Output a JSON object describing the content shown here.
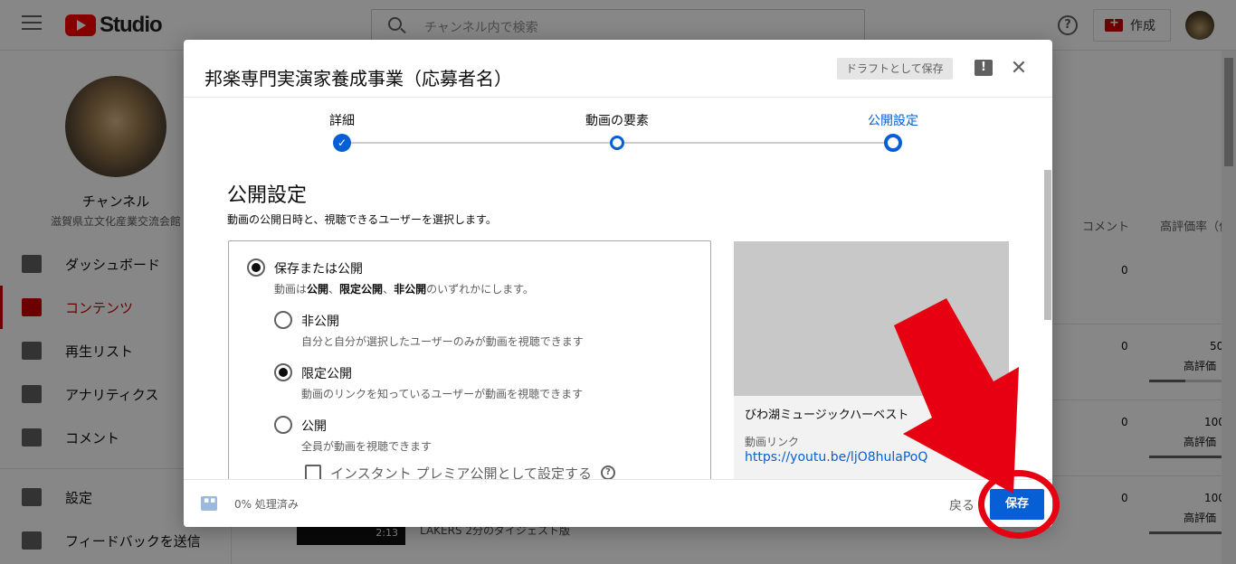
{
  "app": {
    "logo_text": "Studio",
    "search_placeholder": "チャンネル内で検索",
    "help_glyph": "?",
    "create_label": "作成"
  },
  "sidebar": {
    "channel_name": "チャンネル",
    "channel_sub": "滋賀県立文化産業交流会館",
    "items": [
      {
        "label": "ダッシュボード",
        "icon": "dashboard-icon"
      },
      {
        "label": "コンテンツ",
        "icon": "content-icon",
        "active": true
      },
      {
        "label": "再生リスト",
        "icon": "playlist-icon"
      },
      {
        "label": "アナリティクス",
        "icon": "analytics-icon"
      },
      {
        "label": "コメント",
        "icon": "comment-icon"
      },
      {
        "label": "設定",
        "icon": "gear-icon"
      },
      {
        "label": "フィードバックを送信",
        "icon": "feedback-icon"
      }
    ]
  },
  "background_table": {
    "headers": [
      "コメント",
      "高評価率（低評"
    ],
    "rows": [
      {
        "comments": "0",
        "rating": "",
        "rating_label": ""
      },
      {
        "comments": "0",
        "rating": "50",
        "rating_label": "高評価",
        "fill": 0.5
      },
      {
        "comments": "0",
        "rating": "100",
        "rating_label": "高評価",
        "fill": 1.0
      },
      {
        "comments": "0",
        "rating": "100",
        "rating_label": "高評価",
        "fill": 1.0
      }
    ],
    "bottom_thumb_duration": "2:13",
    "bottom_title": "LAKERS 2分のダイジェスト版"
  },
  "dialog": {
    "title": "邦楽専門実演家養成事業（応募者名）",
    "draft_label": "ドラフトとして保存",
    "feedback_glyph": "!",
    "close_glyph": "✕",
    "steps": [
      {
        "label": "詳細",
        "state": "done"
      },
      {
        "label": "動画の要素",
        "state": "visited"
      },
      {
        "label": "公開設定",
        "state": "current"
      }
    ],
    "section_title": "公開設定",
    "section_desc": "動画の公開日時と、視聴できるユーザーを選択します。",
    "save_or_publish": {
      "label": "保存または公開",
      "desc_pre": "動画は",
      "desc_b1": "公開",
      "desc_sep1": "、",
      "desc_b2": "限定公開",
      "desc_sep2": "、",
      "desc_b3": "非公開",
      "desc_post": "のいずれかにします。"
    },
    "options": [
      {
        "label": "非公開",
        "desc": "自分と自分が選択したユーザーのみが動画を視聴できます",
        "selected": false
      },
      {
        "label": "限定公開",
        "desc": "動画のリンクを知っているユーザーが動画を視聴できます",
        "selected": true
      },
      {
        "label": "公開",
        "desc": "全員が動画を視聴できます",
        "selected": false
      }
    ],
    "premiere_label": "インスタント プレミア公開として設定する",
    "premiere_help": "?",
    "preview": {
      "title": "びわ湖ミュージックハーベスト",
      "link_label": "動画リンク",
      "link": "https://youtu.be/ljO8hulaPoQ"
    },
    "footer": {
      "processing": "0% 処理済み",
      "back_label": "戻る",
      "save_label": "保存"
    }
  },
  "colors": {
    "accent": "#065fd4",
    "brand": "#ff0000",
    "annotation": "#e60012"
  }
}
